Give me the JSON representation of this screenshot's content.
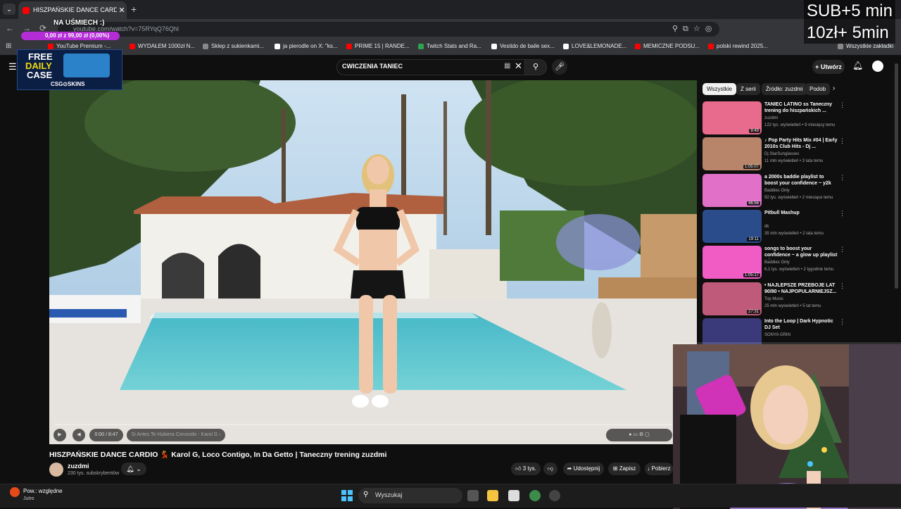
{
  "browser": {
    "tab_title": "HISZPAŃSKIE DANCE CARDIO 💃",
    "url": "youtube.com/watch?v=75RYqQ76Qhl",
    "bookmarks": [
      {
        "label": "YouTube Premium -...",
        "color": "#ff0000"
      },
      {
        "label": "WYDAŁEM 1000zł N...",
        "color": "#ff0000"
      },
      {
        "label": "Sklep z sukienkami...",
        "color": "#888888"
      },
      {
        "label": "ja pierodle on X: \"ks...",
        "color": "#ffffff"
      },
      {
        "label": "PRIME 15 | RANDE...",
        "color": "#ff0000"
      },
      {
        "label": "Twitch Stats and Ra...",
        "color": "#2ea44f"
      },
      {
        "label": "Vestido de baile sex...",
        "color": "#ffffff"
      },
      {
        "label": "LOVE&LEMONADE...",
        "color": "#ffffff"
      },
      {
        "label": "MEMICZNE PODSU...",
        "color": "#ff0000"
      },
      {
        "label": "polski rewind 2025...",
        "color": "#ff0000"
      }
    ],
    "all_bookmarks": "Wszystkie zakładki"
  },
  "overlay": {
    "sub_line1": "SUB+5 min",
    "sub_line2": "10zł+ 5min",
    "goal_title": "NA UŚMIECH :)",
    "goal_progress": "0,00 zł z 99,00 zł (0,00%)",
    "goal_fraction": 0.0,
    "csg_line1": "FREE",
    "csg_line2": "DAILY",
    "csg_line3": "CASE",
    "csg_brand": "CSG⊙SKINS"
  },
  "youtube": {
    "search_value": "CWICZENIA TANIEC",
    "create_label": "Utwórz",
    "chips": [
      "Wszystkie",
      "Z serii",
      "Źródło: zuzdmi",
      "Podob"
    ],
    "player": {
      "time": "0:00 / 8:47",
      "chapter": "Si Antes Te Hubiera Conocido - Karol G ›",
      "progress_fraction": 0.0
    },
    "video_title": "HISZPAŃSKIE DANCE CARDIO 💃 Karol G, Loco Contigo, In Da Getto | Taneczny trening zuzdmi",
    "channel_name": "zuzdmi",
    "channel_subs": "230 tys. subskrybentów",
    "likes": "3 tys.",
    "share_label": "Udostępnij",
    "save_label": "Zapisz",
    "download_label": "Pobierz",
    "recommendations": [
      {
        "title": "TANIEC LATINO ss Taneczny trening do hiszpańskich ...",
        "channel": "zuzdmi",
        "meta": "122 tys. wyświetleń • 9 miesięcy temu",
        "duration": "9:49",
        "color": "#e86a8c"
      },
      {
        "title": "♪ Pop Party Hits Mix #04 | Early 2010s Club Hits - Dj ...",
        "channel": "Dj StarSunglasses",
        "meta": "11 mln wyświetleń • 3 lata temu",
        "duration": "1:05:07",
        "color": "#b8846a"
      },
      {
        "title": "a 2000s baddie playlist to boost your confidence ~ y2k playlist",
        "channel": "Baddies Only",
        "meta": "92 tys. wyświetleń • 2 miesiące temu",
        "duration": "46:56",
        "color": "#e070c8"
      },
      {
        "title": "Pitbull Mashup",
        "channel": "dk",
        "meta": "35 mln wyświetleń • 2 lata temu",
        "duration": "19:11",
        "color": "#2a4c8a"
      },
      {
        "title": "songs to boost your confidence ~ a glow up playlist 💅",
        "channel": "Baddies Only",
        "meta": "6,1 tys. wyświetleń • 2 tygodnie temu",
        "duration": "1:05:17",
        "color": "#f05bc4"
      },
      {
        "title": "• NAJLEPSZE PRZEBOJE LAT 90/80 • NAJPOPULARNIEJSZ...",
        "channel": "Top Music",
        "meta": "25 mln wyświetleń • 5 lat temu",
        "duration": "27:31",
        "color": "#c05a7a"
      },
      {
        "title": "Into the Loop | Dark Hypnotic DJ Set",
        "channel": "SONYA GRIN",
        "meta": "",
        "duration": "",
        "color": "#3a3a7a"
      }
    ]
  },
  "taskbar": {
    "weather1": "Pow.: względne",
    "weather2": "Jutro",
    "search_placeholder": "Wyszukaj"
  }
}
